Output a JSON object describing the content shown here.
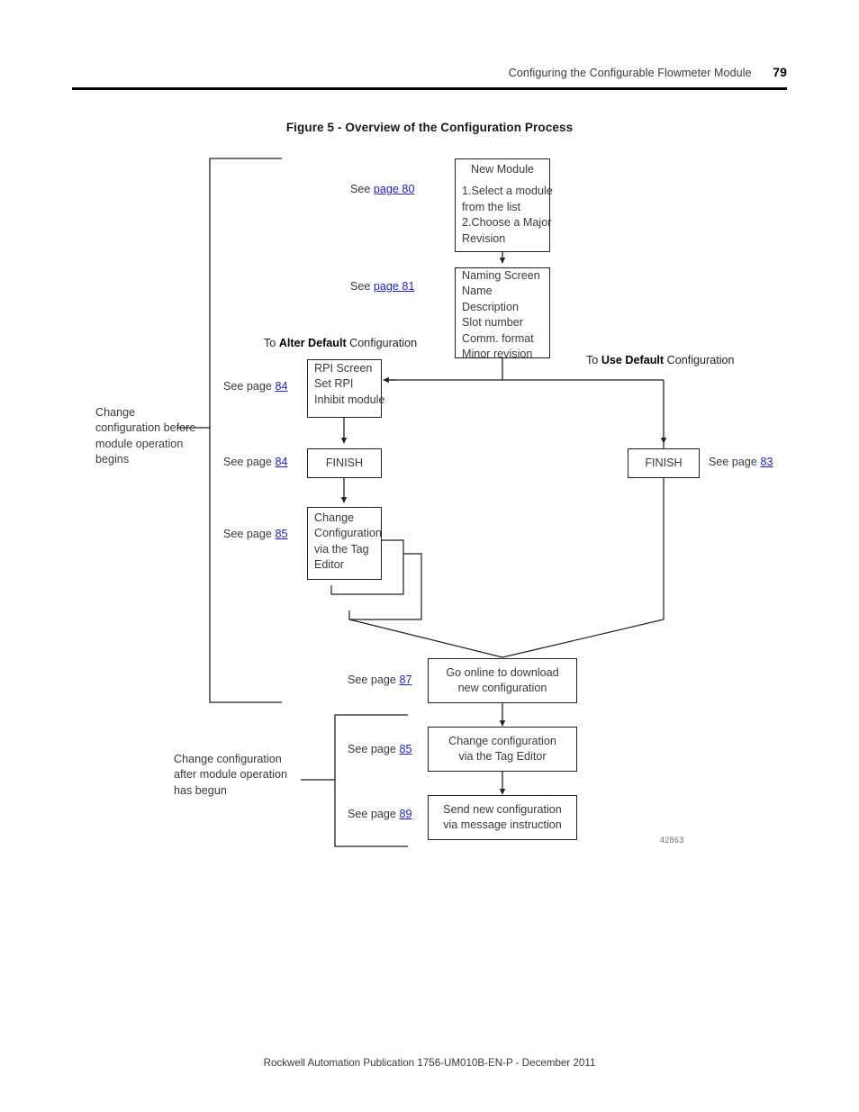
{
  "header": {
    "title": "Configuring the Configurable Flowmeter Module",
    "page_number": "79"
  },
  "figure": {
    "caption": "Figure 5 - Overview of the Configuration Process",
    "id": "42863"
  },
  "footer": {
    "text": "Rockwell Automation Publication 1756-UM010B-EN-P - December 2011"
  },
  "branch_labels": {
    "alter_prefix": "To ",
    "alter_bold": "Alter Default",
    "alter_suffix": " Configuration",
    "use_prefix": "To ",
    "use_bold": "Use Default",
    "use_suffix": " Configuration"
  },
  "side_notes": {
    "before": "Change configuration before module operation begins",
    "after": "Change configuration after module operation has begun"
  },
  "see_labels": {
    "see": "See ",
    "see_page": "See page ",
    "p80": "page 80",
    "p81": "page 81",
    "p84a": "84",
    "p84b": "84",
    "p85a": "85",
    "p83": "83",
    "p87": "87",
    "p85b": "85",
    "p89": "89"
  },
  "boxes": {
    "new_module": {
      "title": "New Module",
      "lines": [
        "1.Select a module",
        "from the list",
        "2.Choose a Major",
        "Revision"
      ]
    },
    "naming_screen": {
      "lines": [
        "Naming Screen",
        "Name",
        "Description",
        "Slot number",
        "Comm. format",
        "Minor revision"
      ]
    },
    "rpi_screen": {
      "lines": [
        "RPI Screen",
        "Set RPI",
        "Inhibit module"
      ]
    },
    "finish_left": {
      "label": "FINISH"
    },
    "finish_right": {
      "label": "FINISH"
    },
    "change_config_tag": {
      "lines": [
        "Change",
        "Configuration",
        "via the Tag",
        "Editor"
      ]
    },
    "go_online": {
      "lines": [
        "Go online to download",
        "new configuration"
      ]
    },
    "change_config_tag2": {
      "lines": [
        "Change configuration",
        "via the Tag Editor"
      ]
    },
    "send_config": {
      "lines": [
        "Send new configuration",
        "via message instruction"
      ]
    }
  },
  "colors": {
    "link": "#2222cc",
    "ink": "#231f20",
    "text": "#3a3a3a"
  }
}
